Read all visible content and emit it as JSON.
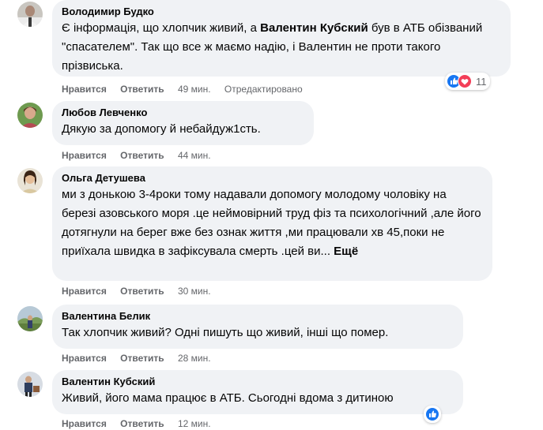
{
  "comments": [
    {
      "author": "Володимир Будко",
      "text_before": "Є інформація, що хлопчик живий, а ",
      "text_bold": "Валентин Кубский",
      "text_after": " був в АТБ обізваний \"спасателем\". Так що все ж маємо надію, і Валентин не проти такого прізвиська.",
      "like": "Нравится",
      "reply": "Ответить",
      "time": "49 мин.",
      "edited": "Отредактировано",
      "reaction_count": "11",
      "reaction_icons": [
        "like-icon",
        "love-icon"
      ]
    },
    {
      "author": "Любов Левченко",
      "text": "Дякую за допомогу й небайдуж1сть.",
      "like": "Нравится",
      "reply": "Ответить",
      "time": "44 мин."
    },
    {
      "author": "Ольга Детушева",
      "text": "ми з донькою 3-4роки тому надавали допомогу молодому чоловіку на березі азовського моря .це неймовірний труд фіз та психологічний ,але його дотягнули на берег вже без ознак життя ,ми працювали хв 45,поки не приїхала швидка в зафіксувала смерть .цей ви...",
      "more": "Ещё",
      "like": "Нравится",
      "reply": "Ответить",
      "time": "30 мин."
    },
    {
      "author": "Валентина Белик",
      "text": "Так хлопчик живий? Одні пишуть що живий, інші що помер.",
      "like": "Нравится",
      "reply": "Ответить",
      "time": "28 мин."
    },
    {
      "author": "Валентин Кубский",
      "text": "Живий, його мама працює в АТБ. Сьогодні вдома з дитиною",
      "like": "Нравится",
      "reply": "Ответить",
      "time": "12 мин.",
      "reaction_icons": [
        "like-icon"
      ]
    }
  ],
  "colors": {
    "bubble": "#f0f2f5",
    "meta_text": "#65676b",
    "like_blue": "#1877f2",
    "love_red": "#f33e58"
  }
}
